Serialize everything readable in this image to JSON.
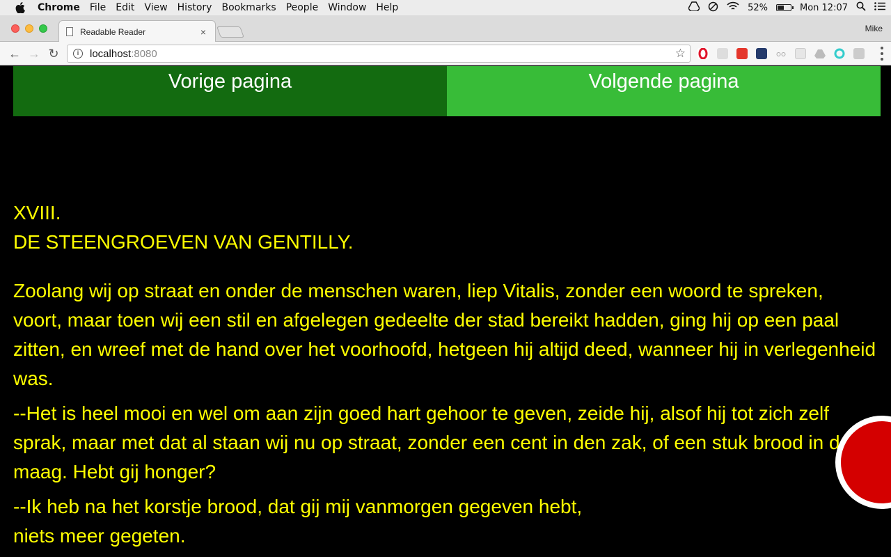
{
  "menubar": {
    "app": "Chrome",
    "items": [
      "File",
      "Edit",
      "View",
      "History",
      "Bookmarks",
      "People",
      "Window",
      "Help"
    ],
    "battery_percent": "52%",
    "battery_level": 0.52,
    "clock": "Mon 12:07"
  },
  "tab": {
    "title": "Readable Reader",
    "close_glyph": "×"
  },
  "profile": {
    "name": "Mike"
  },
  "omnibox": {
    "host": "localhost",
    "port": ":8080",
    "info_glyph": "i",
    "star_glyph": "☆"
  },
  "nav": {
    "back_glyph": "←",
    "forward_glyph": "→",
    "reload_glyph": "↻"
  },
  "reader": {
    "prev_label": "Vorige pagina",
    "next_label": "Volgende pagina",
    "chapter_number": "XVIII.",
    "chapter_title": "DE STEENGROEVEN VAN GENTILLY.",
    "paragraphs": [
      "Zoolang wij op straat en onder de menschen waren, liep Vitalis, zonder een woord te spreken, voort, maar toen wij een stil en afgelegen gedeelte der stad bereikt hadden, ging hij op een paal zitten, en wreef met de hand over het voorhoofd, hetgeen hij altijd deed, wanneer hij in verlegenheid was.",
      "--Het is heel mooi en wel om aan zijn goed hart gehoor te geven, zeide hij, alsof hij tot zich zelf sprak, maar met dat al staan wij nu op straat, zonder een cent in den zak, of een stuk brood in de maag. Hebt gij honger?",
      "--Ik heb na het korstje brood, dat gij mij vanmorgen gegeven hebt,",
      "niets meer gegeten."
    ]
  }
}
